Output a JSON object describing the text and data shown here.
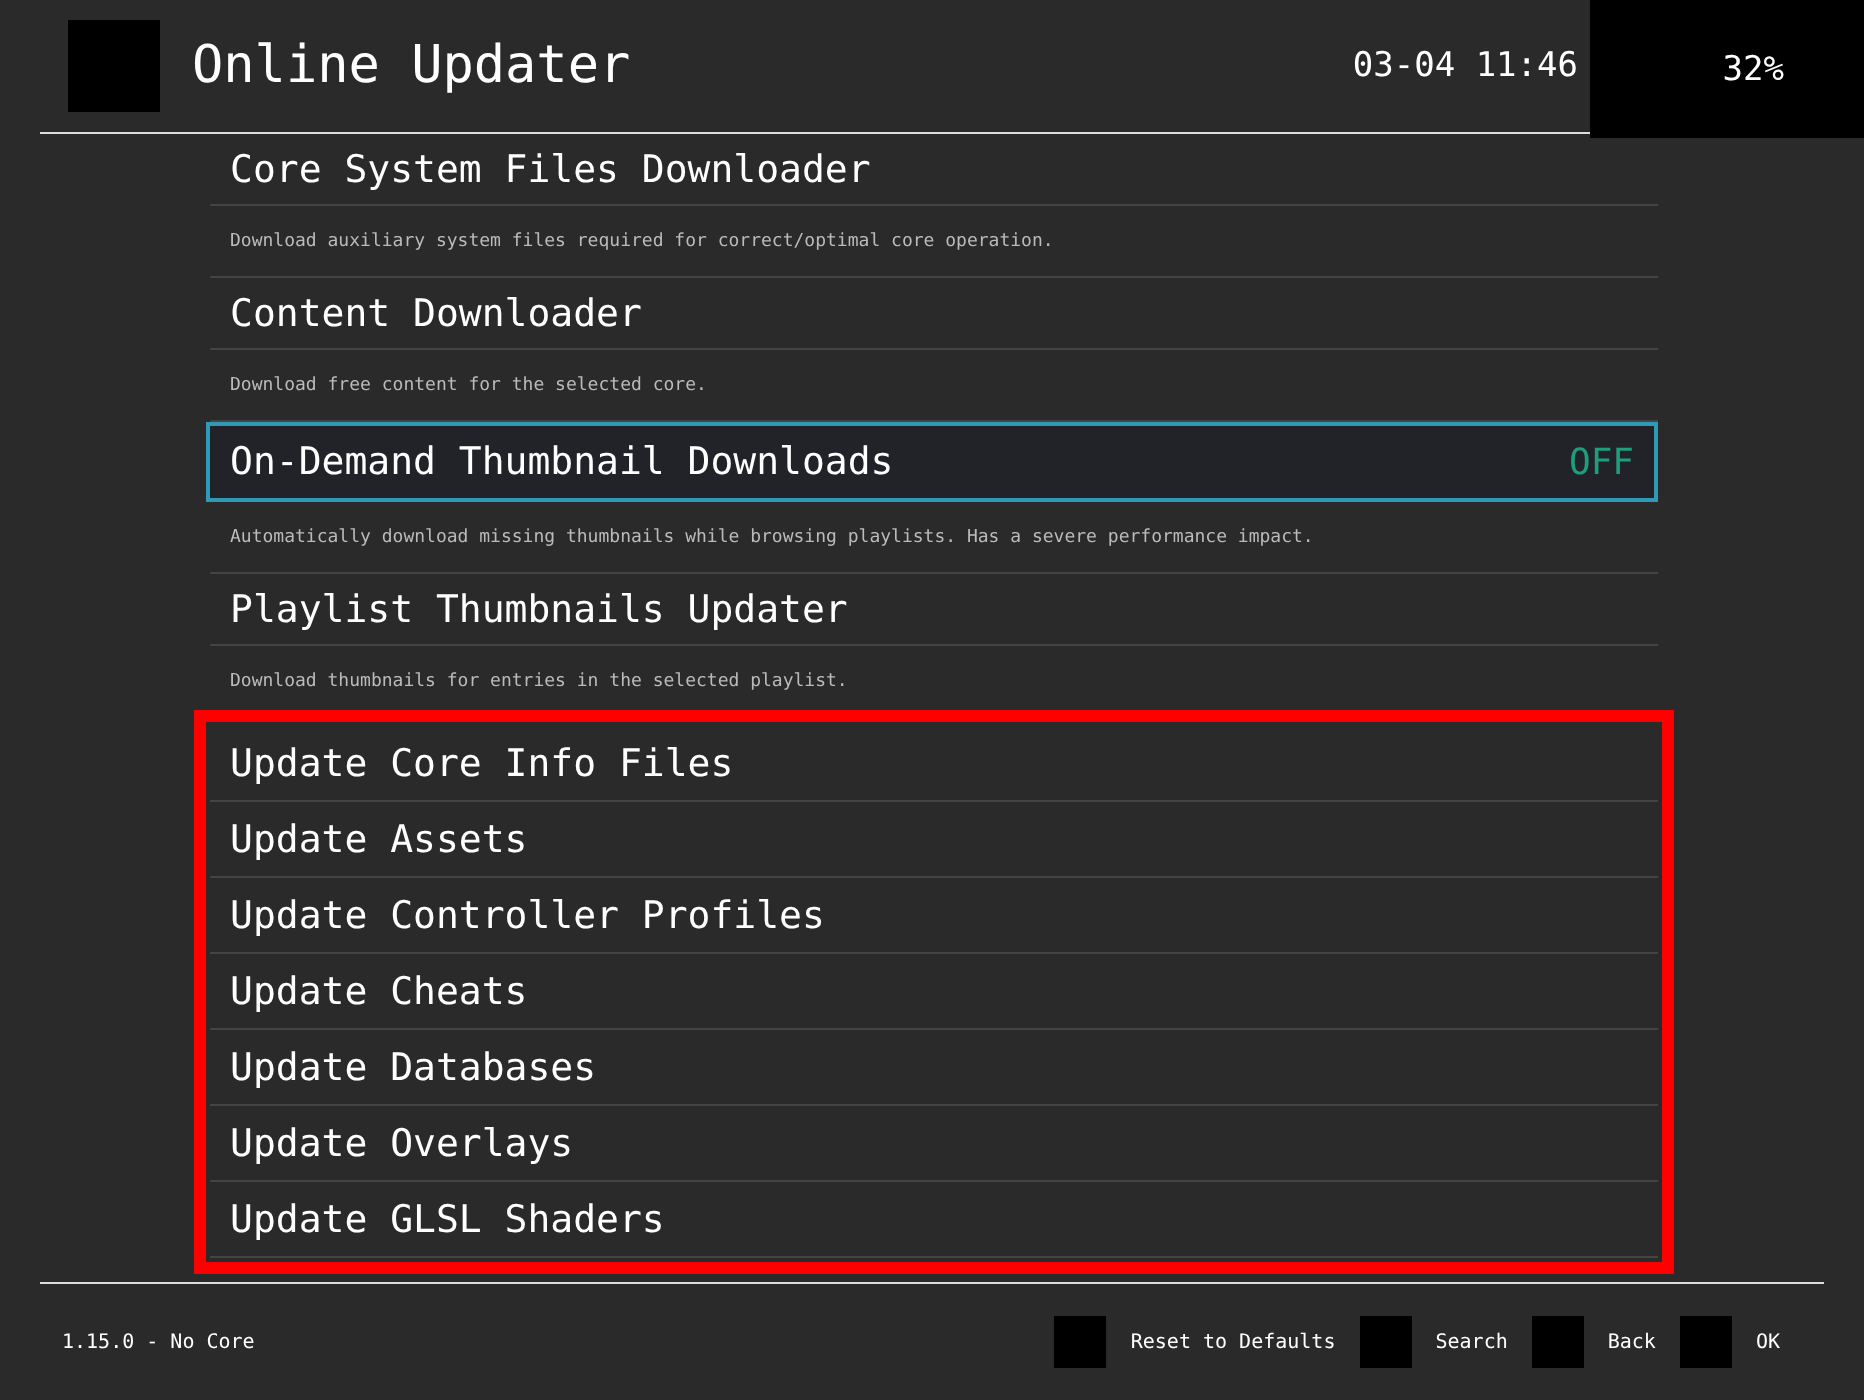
{
  "header": {
    "title": "Online Updater",
    "clock": "03-04 11:46",
    "battery": "32%"
  },
  "menu": {
    "items": [
      {
        "label": "Core System Files Downloader",
        "description": "Download auxiliary system files required for correct/optimal core operation.",
        "selected": false
      },
      {
        "label": "Content Downloader",
        "description": "Download free content for the selected core.",
        "selected": false
      },
      {
        "label": "On-Demand Thumbnail Downloads",
        "value": "OFF",
        "description": "Automatically download missing thumbnails while browsing playlists. Has a severe performance impact.",
        "selected": true
      },
      {
        "label": "Playlist Thumbnails Updater",
        "description": "Download thumbnails for entries in the selected playlist.",
        "selected": false
      }
    ],
    "highlighted_items": [
      {
        "label": "Update Core Info Files",
        "selected": false
      },
      {
        "label": "Update Assets",
        "selected": false
      },
      {
        "label": "Update Controller Profiles",
        "selected": false
      },
      {
        "label": "Update Cheats",
        "selected": false
      },
      {
        "label": "Update Databases",
        "selected": false
      },
      {
        "label": "Update Overlays",
        "selected": false
      },
      {
        "label": "Update GLSL Shaders",
        "selected": false
      }
    ]
  },
  "footer": {
    "version": "1.15.0 - No Core",
    "actions": [
      "Reset to Defaults",
      "Search",
      "Back",
      "OK"
    ]
  }
}
